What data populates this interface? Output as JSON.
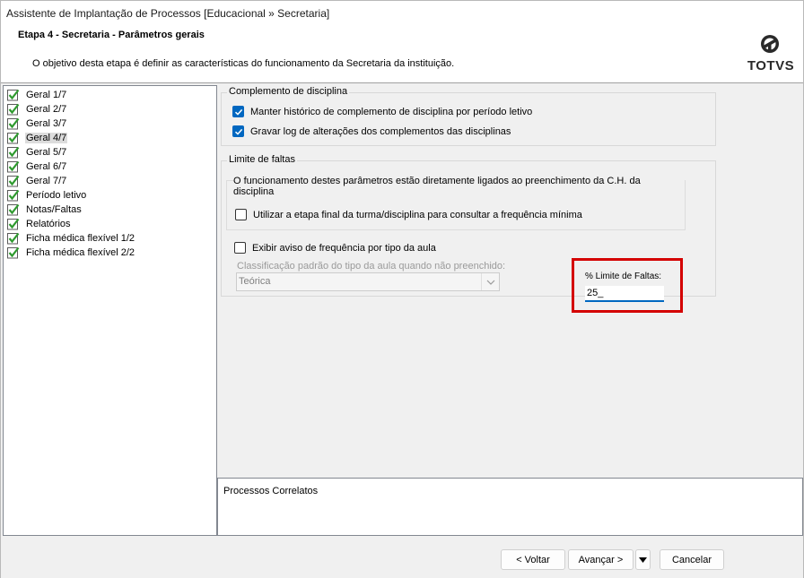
{
  "window": {
    "title": "Assistente de Implantação de Processos [Educacional » Secretaria]"
  },
  "header": {
    "step": "Etapa 4 - Secretaria - Parâmetros gerais",
    "description": "O objetivo desta etapa é definir as características do funcionamento da Secretaria da instituição.",
    "logo_text": "TOTVS"
  },
  "tree": {
    "items": [
      {
        "label": "Geral 1/7",
        "selected": false
      },
      {
        "label": "Geral 2/7",
        "selected": false
      },
      {
        "label": "Geral 3/7",
        "selected": false
      },
      {
        "label": "Geral 4/7",
        "selected": true
      },
      {
        "label": "Geral 5/7",
        "selected": false
      },
      {
        "label": "Geral 6/7",
        "selected": false
      },
      {
        "label": "Geral 7/7",
        "selected": false
      },
      {
        "label": "Período letivo",
        "selected": false
      },
      {
        "label": "Notas/Faltas",
        "selected": false
      },
      {
        "label": "Relatórios",
        "selected": false
      },
      {
        "label": "Ficha médica flexível 1/2",
        "selected": false
      },
      {
        "label": "Ficha médica flexível 2/2",
        "selected": false
      }
    ]
  },
  "complemento": {
    "title": "Complemento de disciplina",
    "manter_label": "Manter histórico de complemento de disciplina por período letivo",
    "manter_checked": true,
    "gravar_label": "Gravar log de alterações dos complementos das disciplinas",
    "gravar_checked": true
  },
  "limite": {
    "title": "Limite de faltas",
    "note": "O funcionamento destes parâmetros estão diretamente ligados ao preenchimento da C.H. da disciplina",
    "utilizar_label": "Utilizar a etapa final da turma/disciplina para consultar a frequência mínima",
    "utilizar_checked": false,
    "percent_label": "% Limite de Faltas:",
    "percent_value": "25_",
    "exibir_label": "Exibir aviso de frequência por tipo da aula",
    "exibir_checked": false,
    "classificacao_label": "Classificação padrão do tipo da aula quando não preenchido:",
    "classificacao_value": "Teórica"
  },
  "related": {
    "label": "Processos Correlatos"
  },
  "footer": {
    "back_label": "< Voltar",
    "next_label": "Avançar >",
    "cancel_label": "Cancelar"
  },
  "colors": {
    "accent": "#0067c0",
    "highlight_border": "#d40000",
    "check_green": "#2e9a2e"
  }
}
